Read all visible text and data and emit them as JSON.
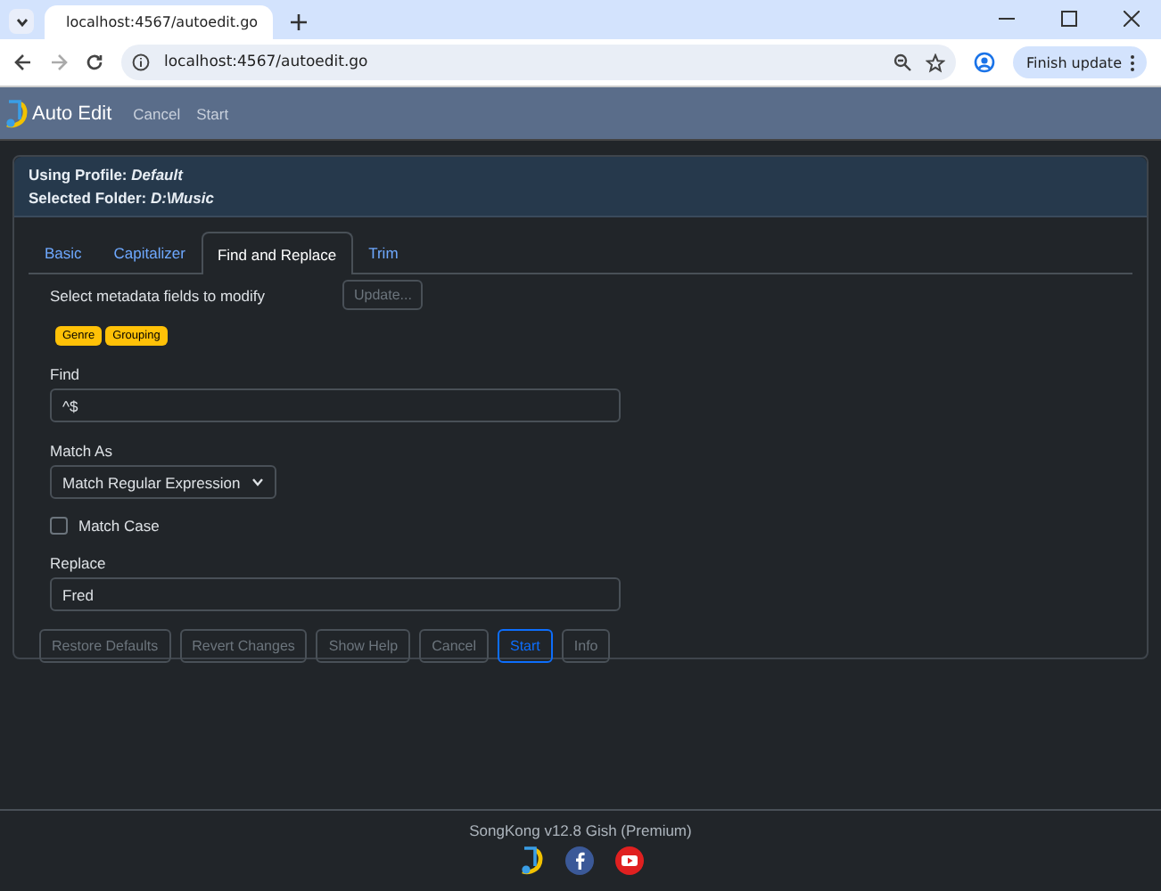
{
  "browser": {
    "tab_title": "localhost:4567/autoedit.go",
    "url": "localhost:4567/autoedit.go",
    "update_button": "Finish update"
  },
  "nav": {
    "brand": "Auto Edit",
    "links": [
      "Cancel",
      "Start"
    ]
  },
  "header": {
    "profile": "Using Profile: *Default*",
    "folder": "Selected Folder: *D:\\Music*"
  },
  "tabs": [
    {
      "label": "Basic",
      "selected": false
    },
    {
      "label": "Capitalizer",
      "selected": false
    },
    {
      "label": "Find and Replace",
      "selected": true
    },
    {
      "label": "Trim",
      "selected": false
    }
  ],
  "fields": {
    "label": "Select metadata fields to modify",
    "update_button": {
      "label": "Update...",
      "disabled": true
    },
    "tags": [
      "Genre",
      "Grouping"
    ]
  },
  "find": {
    "label": "Find",
    "value": "^$"
  },
  "match_as": {
    "label": "Match As",
    "value": "Match Regular Expression"
  },
  "match_case": {
    "label": "Match Case",
    "checked": false
  },
  "replace": {
    "label": "Replace",
    "value": "Fred"
  },
  "buttons": [
    {
      "label": "Restore Defaults",
      "primary": false
    },
    {
      "label": "Revert Changes",
      "primary": false
    },
    {
      "label": "Show Help",
      "primary": false
    },
    {
      "label": "Cancel",
      "primary": false
    },
    {
      "label": "Start",
      "primary": true
    },
    {
      "label": "Info",
      "primary": false
    }
  ],
  "footer": {
    "version": "SongKong v12.8 Gish (Premium)"
  }
}
